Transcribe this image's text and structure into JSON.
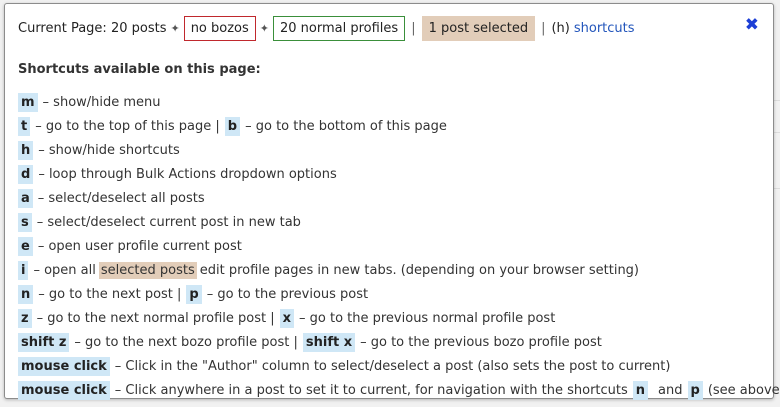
{
  "topbar": {
    "current_page": "Current Page: 20 posts",
    "sep1": "✦",
    "no_bozos": "no bozos",
    "sep2": "✦",
    "normal_profiles": "20 normal profiles",
    "pipe1": "|",
    "selected": "1 post selected",
    "pipe2": "|",
    "h_label": "(h)",
    "shortcuts_link": "shortcuts",
    "close_glyph": "✖"
  },
  "title": "Shortcuts available on this page:",
  "shortcuts": [
    {
      "key": "m",
      "desc": "– show/hide menu"
    },
    {
      "key": "t",
      "desc": "– go to the top of this page |",
      "key2": "b",
      "desc2": "– go to the bottom of this page"
    },
    {
      "key": "h",
      "desc": "– show/hide shortcuts"
    },
    {
      "key": "d",
      "desc": "– loop through Bulk Actions dropdown options"
    },
    {
      "key": "a",
      "desc": "– select/deselect all posts"
    },
    {
      "key": "s",
      "desc": "– select/deselect current post in new tab"
    },
    {
      "key": "e",
      "desc": "– open user profile current post"
    },
    {
      "key": "i",
      "desc": "– open all",
      "highlight": "selected posts",
      "desc_after": "edit profile pages in new tabs. (depending on your browser setting)"
    },
    {
      "key": "n",
      "desc": "– go to the next post |",
      "key2": "p",
      "desc2": "– go to the previous post"
    },
    {
      "key": "z",
      "desc": "– go to the next normal profile post |",
      "key2": "x",
      "desc2": "– go to the previous normal profile post"
    },
    {
      "key": "shift z",
      "desc": "– go to the next bozo profile post |",
      "key2": "shift x",
      "desc2": "– go to the previous bozo profile post"
    },
    {
      "key": "mouse click",
      "desc": "– Click in the \"Author\" column to select/deselect a post (also sets the post to current)"
    },
    {
      "key": "mouse click",
      "desc": "– Click anywhere in a post to set it to current, for navigation with the shortcuts",
      "key2": "n",
      "mid": "and",
      "key3": "p",
      "desc3": "(see above)"
    }
  ],
  "colors": {
    "key_bg": "#cfe7f6",
    "selected_bg": "#e2cdb9",
    "no_bozos_border": "#c0282d",
    "normal_profiles_border": "#3a8f3a",
    "link": "#2255bb",
    "close": "#1d3fd6"
  }
}
